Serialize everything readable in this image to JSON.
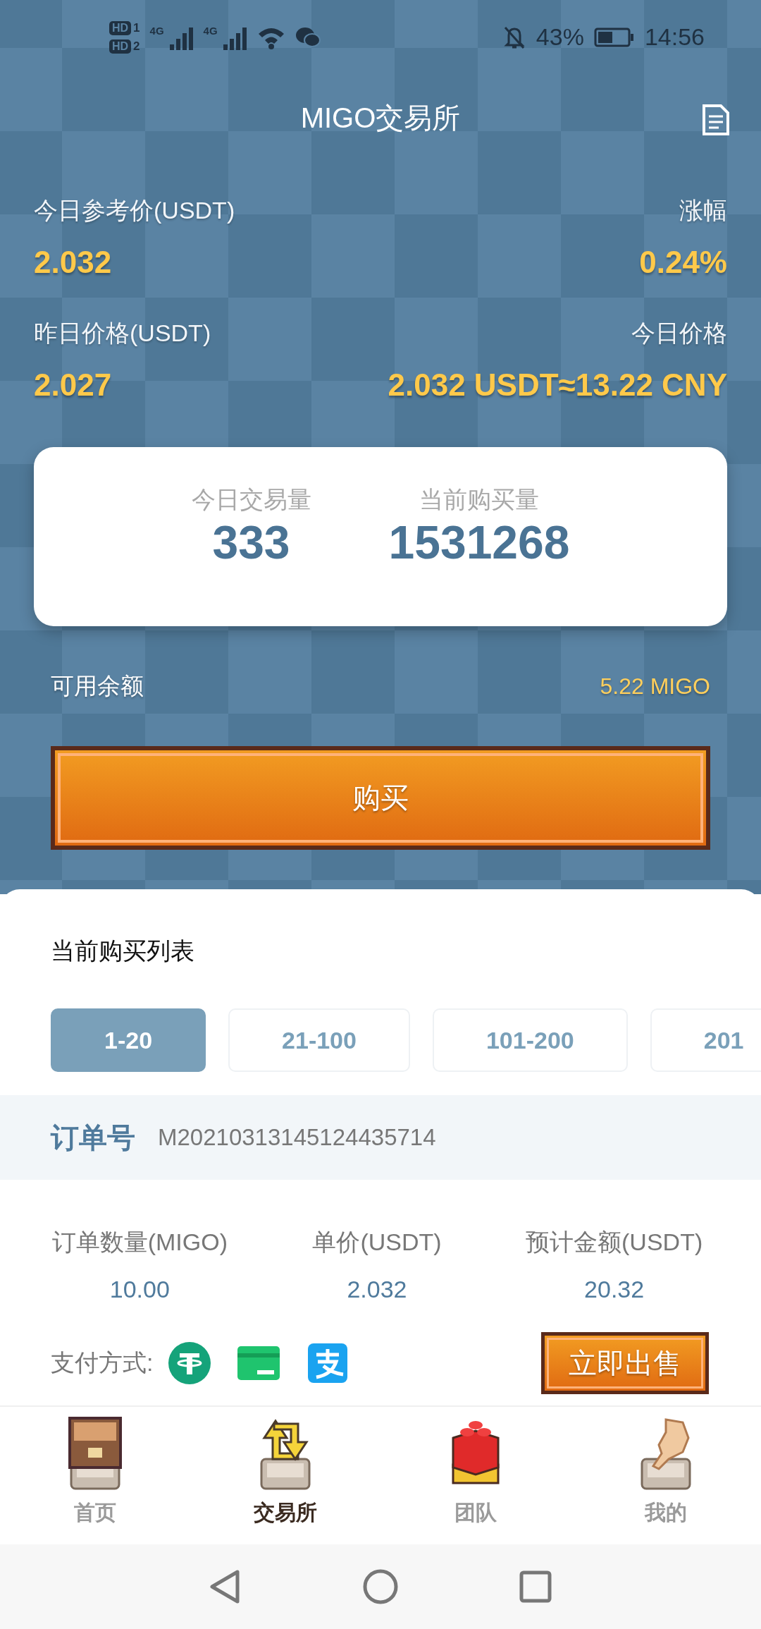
{
  "status_bar": {
    "sims": [
      {
        "badge": "HD",
        "slot": "1",
        "network": "4G"
      },
      {
        "badge": "HD",
        "slot": "2",
        "network": "4G"
      }
    ],
    "battery": "43%",
    "time": "14:56"
  },
  "header": {
    "title": "MIGO交易所"
  },
  "prices": [
    {
      "label": "今日参考价(USDT)",
      "value": "2.032"
    },
    {
      "label": "涨幅",
      "value": "0.24%"
    },
    {
      "label": "昨日价格(USDT)",
      "value": "2.027"
    },
    {
      "label": "今日价格",
      "value": "2.032 USDT≈13.22 CNY"
    }
  ],
  "summary": [
    {
      "label": "今日交易量",
      "value": "333"
    },
    {
      "label": "当前购买量",
      "value": "1531268"
    }
  ],
  "balance": {
    "label": "可用余额",
    "value": "5.22 MIGO"
  },
  "buy_button": "购买",
  "list": {
    "title": "当前购买列表",
    "tabs": [
      {
        "label": "1-20",
        "selected": true
      },
      {
        "label": "21-100",
        "selected": false
      },
      {
        "label": "101-200",
        "selected": false
      },
      {
        "label": "201",
        "selected": false
      }
    ],
    "order": {
      "label": "订单号",
      "number": "M20210313145124435714"
    },
    "columns": [
      {
        "label": "订单数量(MIGO)",
        "value": "10.00"
      },
      {
        "label": "单价(USDT)",
        "value": "2.032"
      },
      {
        "label": "预计金额(USDT)",
        "value": "20.32"
      }
    ],
    "payment_label": "支付方式:",
    "sell_button": "立即出售"
  },
  "nav": [
    {
      "label": "首页",
      "selected": false
    },
    {
      "label": "交易所",
      "selected": true
    },
    {
      "label": "团队",
      "selected": false
    },
    {
      "label": "我的",
      "selected": false
    }
  ]
}
